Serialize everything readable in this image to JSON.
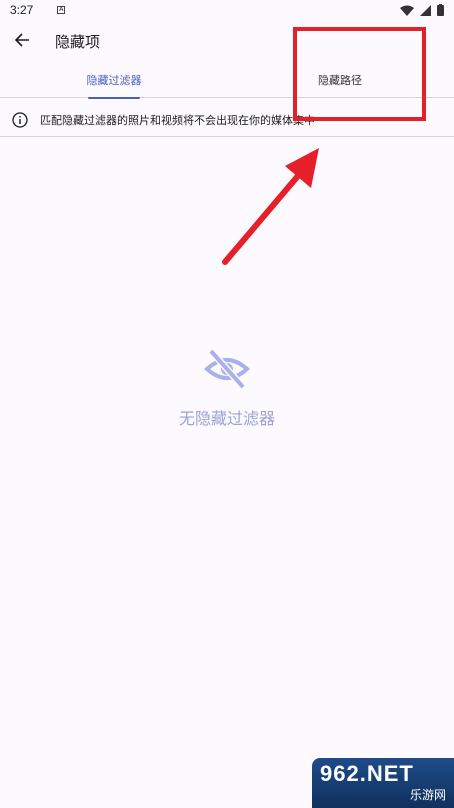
{
  "status_bar": {
    "time": "3:27",
    "notification_glyph": "A"
  },
  "app_bar": {
    "title": "隐藏项"
  },
  "tabs": [
    {
      "label": "隐藏过滤器",
      "selected": true
    },
    {
      "label": "隐藏路径",
      "selected": false
    }
  ],
  "info": {
    "text": "匹配隐藏过滤器的照片和视频将不会出现在你的媒体集中"
  },
  "empty": {
    "message": "无隐藏过滤器",
    "icon": "eye-off-icon"
  },
  "watermark": {
    "logo": "962.NET",
    "sub": "乐游网"
  },
  "colors": {
    "accent": "#4a5ec5",
    "annotation": "#e62028",
    "background": "#fcf9ff"
  }
}
